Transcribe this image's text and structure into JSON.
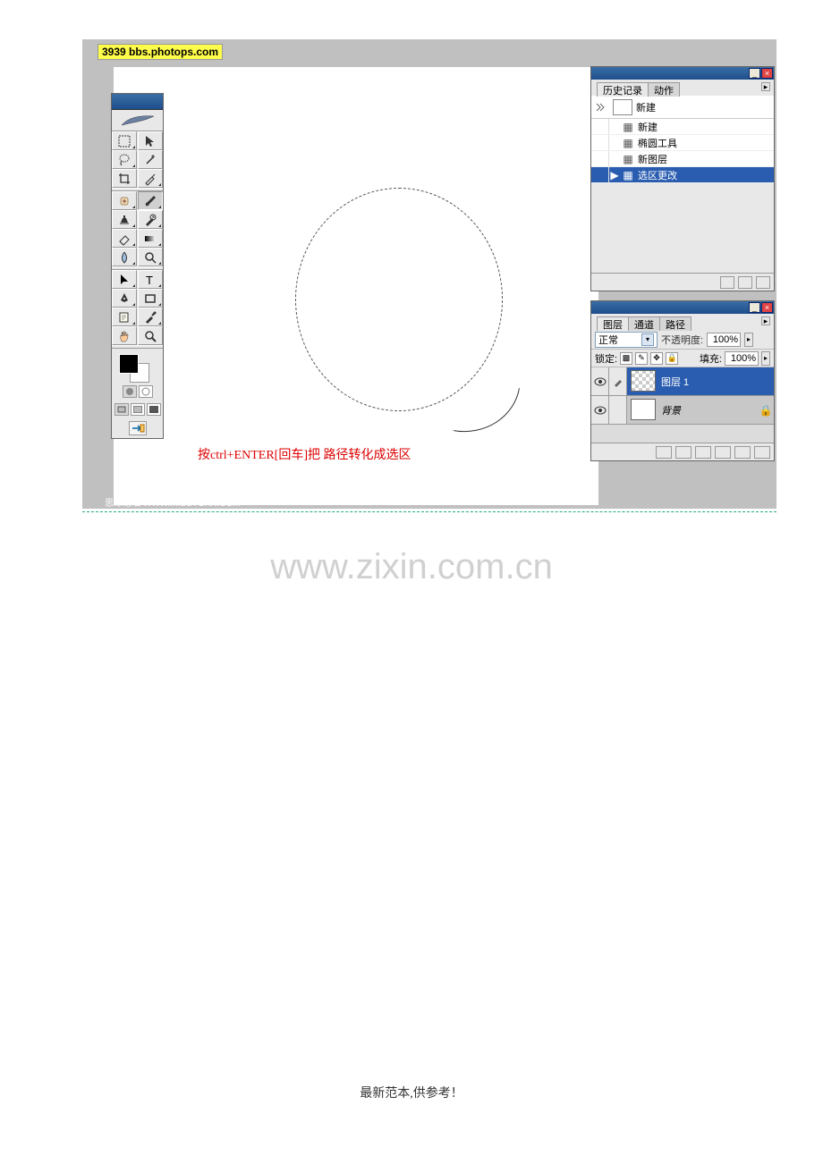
{
  "header_badge": "3939  bbs.photops.com",
  "annotation": "按ctrl+ENTER[回车]把 路径转化成选区",
  "source": "思缘论坛   WWW.MISSYUAN.COM",
  "watermark": "www.zixin.com.cn",
  "footer": "最新范本,供参考！",
  "history_panel": {
    "tabs": [
      "历史记录",
      "动作"
    ],
    "snapshot": "新建",
    "items": [
      "新建",
      "椭圆工具",
      "新图层",
      "选区更改"
    ]
  },
  "layers_panel": {
    "tabs": [
      "图层",
      "通道",
      "路径"
    ],
    "blend_mode": "正常",
    "opacity_label": "不透明度:",
    "opacity_value": "100%",
    "lock_label": "锁定:",
    "fill_label": "填充:",
    "fill_value": "100%",
    "layers": [
      {
        "name": "图层 1",
        "active": true,
        "transparent": true,
        "locked": false
      },
      {
        "name": "背景",
        "active": false,
        "transparent": false,
        "locked": true
      }
    ]
  }
}
